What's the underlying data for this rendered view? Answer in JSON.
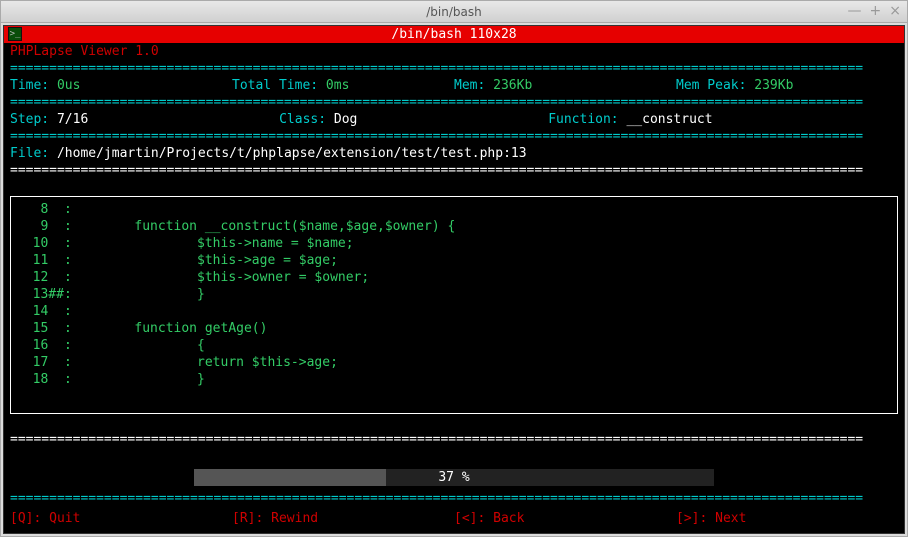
{
  "window": {
    "title": "/bin/bash",
    "controls": {
      "min": "—",
      "max": "+",
      "close": "×"
    }
  },
  "tab": {
    "title": "/bin/bash 110x28"
  },
  "app": {
    "title": "PHPLapse Viewer 1.0"
  },
  "divider_cyan": "=============================================================================================================",
  "divider_white": "=============================================================================================================",
  "stats1": {
    "time_label": "Time:",
    "time_value": "0us",
    "total_label": "Total Time:",
    "total_value": "0ms",
    "mem_label": "Mem:",
    "mem_value": "236Kb",
    "peak_label": "Mem Peak:",
    "peak_value": "239Kb"
  },
  "stats2": {
    "step_label": "Step:",
    "step_value": "7/16",
    "class_label": "Class:",
    "class_value": "Dog",
    "func_label": "Function:",
    "func_value": "__construct"
  },
  "file": {
    "label": "File:",
    "path": "/home/jmartin/Projects/t/phplapse/extension/test/test.php:13"
  },
  "code": {
    "lines": [
      {
        "n": "8",
        "m": "  :",
        "t": ""
      },
      {
        "n": "9",
        "m": "  :",
        "t": "        function __construct($name,$age,$owner) {"
      },
      {
        "n": "10",
        "m": "  :",
        "t": "                $this->name = $name;"
      },
      {
        "n": "11",
        "m": "  :",
        "t": "                $this->age = $age;"
      },
      {
        "n": "12",
        "m": "  :",
        "t": "                $this->owner = $owner;"
      },
      {
        "n": "13",
        "m": "##:",
        "t": "                }"
      },
      {
        "n": "14",
        "m": "  :",
        "t": ""
      },
      {
        "n": "15",
        "m": "  :",
        "t": "        function getAge()"
      },
      {
        "n": "16",
        "m": "  :",
        "t": "                {"
      },
      {
        "n": "17",
        "m": "  :",
        "t": "                return $this->age;"
      },
      {
        "n": "18",
        "m": "  :",
        "t": "                }"
      }
    ]
  },
  "progress": {
    "percent": 37,
    "text": "37 %"
  },
  "footer": {
    "quit_key": "[Q]:",
    "quit_label": " Quit",
    "rewind_key": "[R]:",
    "rewind_label": " Rewind",
    "back_key": "[<]:",
    "back_label": " Back",
    "next_key": "[>]:",
    "next_label": " Next"
  }
}
